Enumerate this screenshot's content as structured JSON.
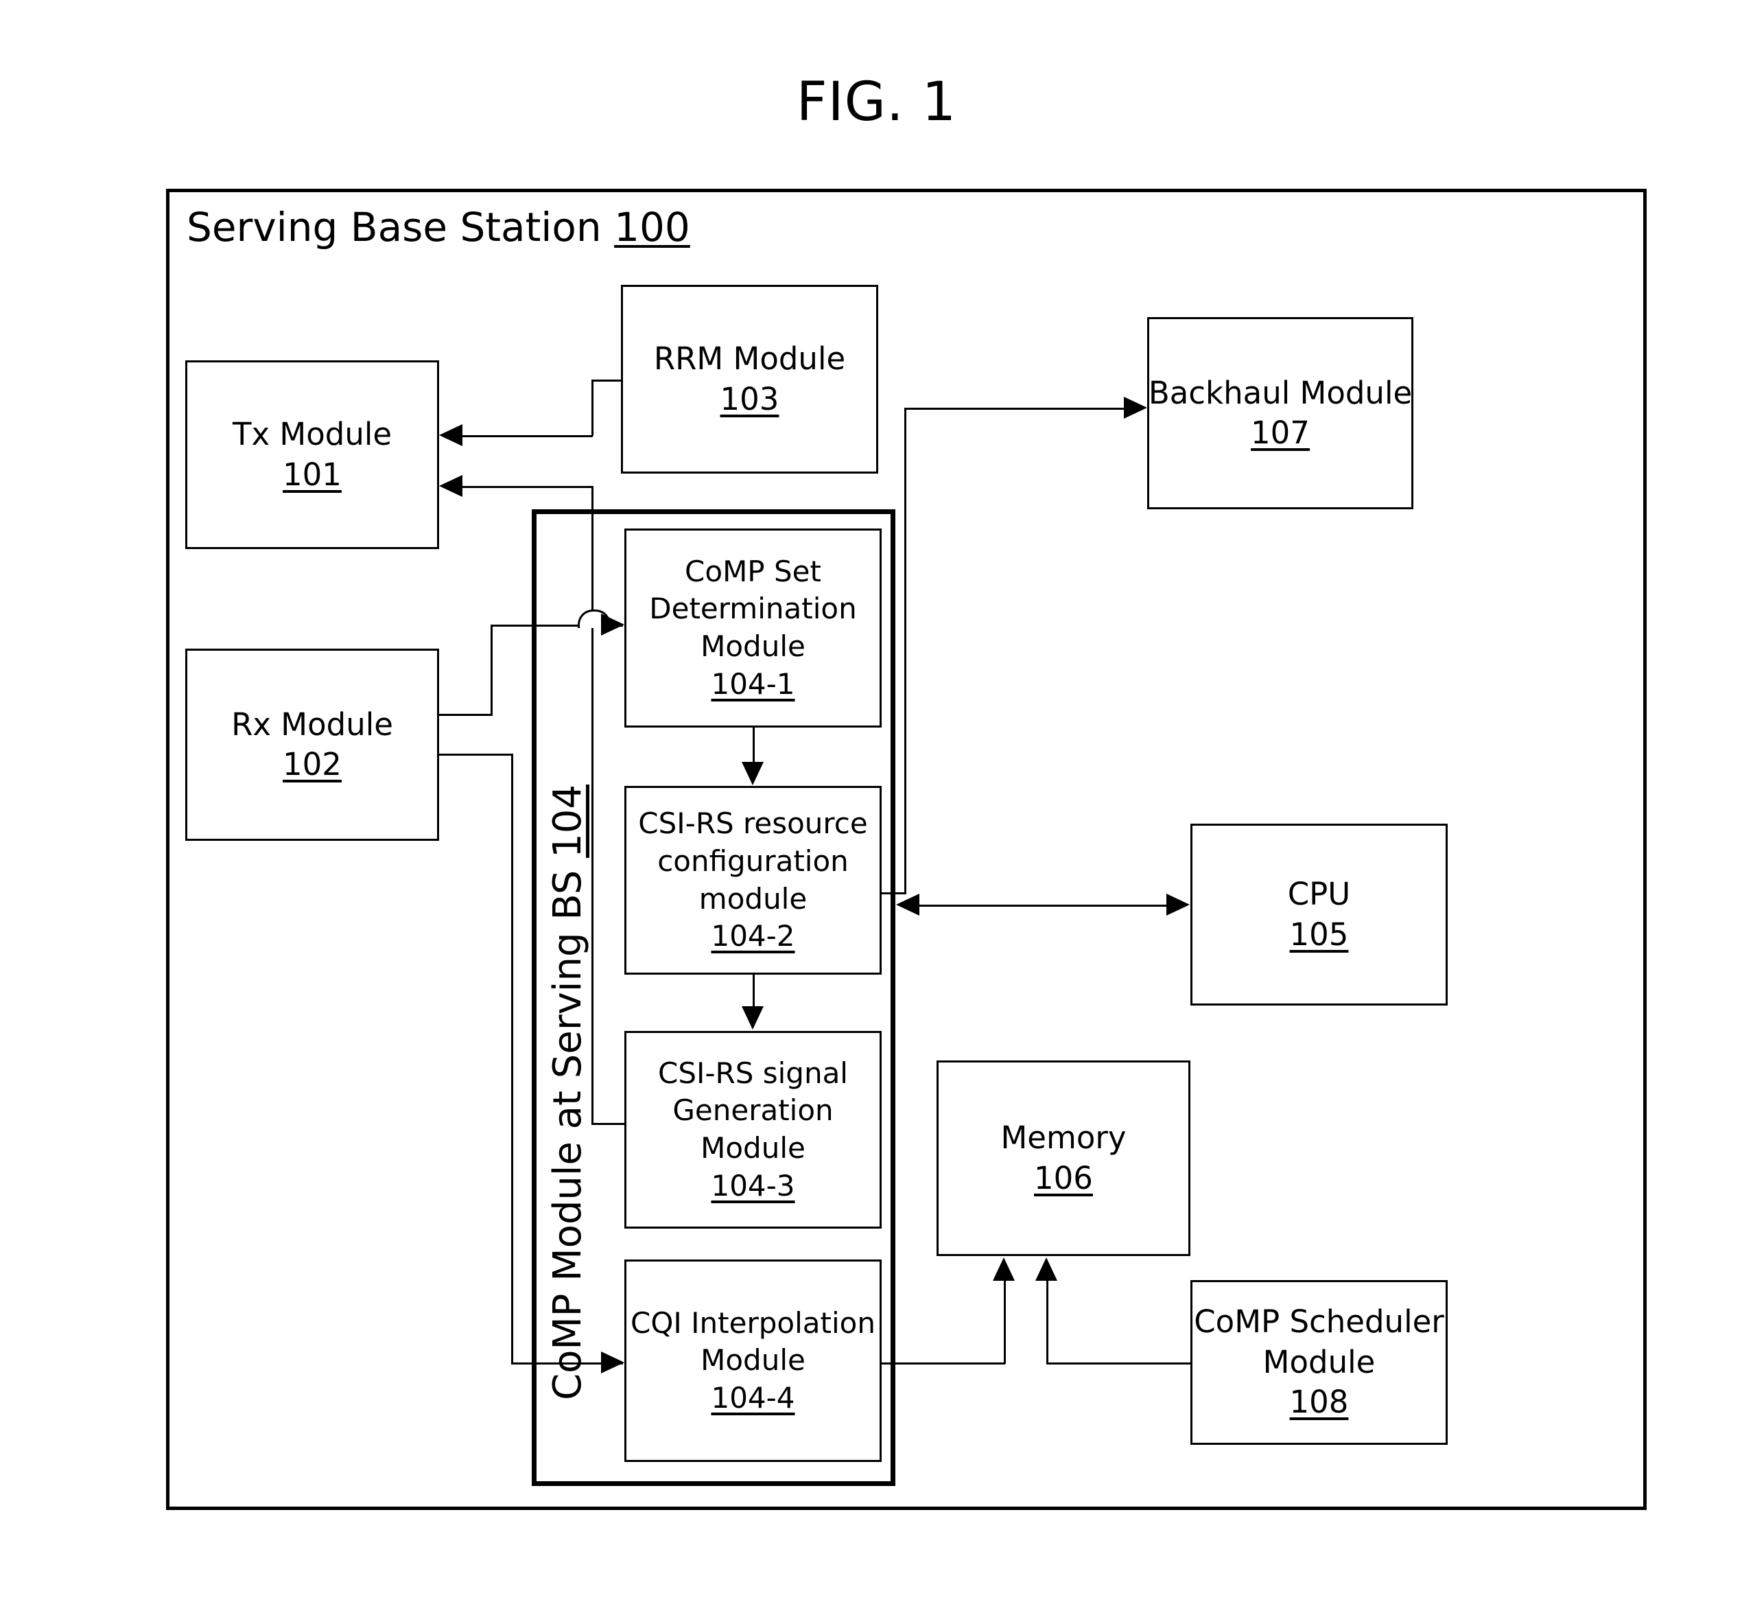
{
  "figure": {
    "title": "FIG. 1"
  },
  "frame": {
    "label": "Serving Base Station",
    "ref": "100"
  },
  "comp_container": {
    "label": "CoMP Module at Serving BS",
    "ref": "104"
  },
  "modules": {
    "tx": {
      "line1": "Tx Module",
      "ref": "101"
    },
    "rx": {
      "line1": "Rx Module",
      "ref": "102"
    },
    "rrm": {
      "line1": "RRM Module",
      "ref": "103"
    },
    "comp_set_determination": {
      "line1": "CoMP Set",
      "line2": "Determination",
      "line3": "Module",
      "ref": "104-1"
    },
    "csi_rs_resource_configuration": {
      "line1": "CSI-RS resource",
      "line2": "configuration",
      "line3": "module",
      "ref": "104-2"
    },
    "csi_rs_signal_generation": {
      "line1": "CSI-RS signal",
      "line2": "Generation",
      "line3": "Module",
      "ref": "104-3"
    },
    "cqi_interpolation": {
      "line1": "CQI Interpolation",
      "line2": "Module",
      "ref": "104-4"
    },
    "cpu": {
      "line1": "CPU",
      "ref": "105"
    },
    "memory": {
      "line1": "Memory",
      "ref": "106"
    },
    "backhaul": {
      "line1": "Backhaul Module",
      "ref": "107"
    },
    "comp_scheduler": {
      "line1": "CoMP Scheduler",
      "line2": "Module",
      "ref": "108"
    }
  },
  "colors": {
    "stroke": "#000000",
    "background": "#ffffff"
  }
}
